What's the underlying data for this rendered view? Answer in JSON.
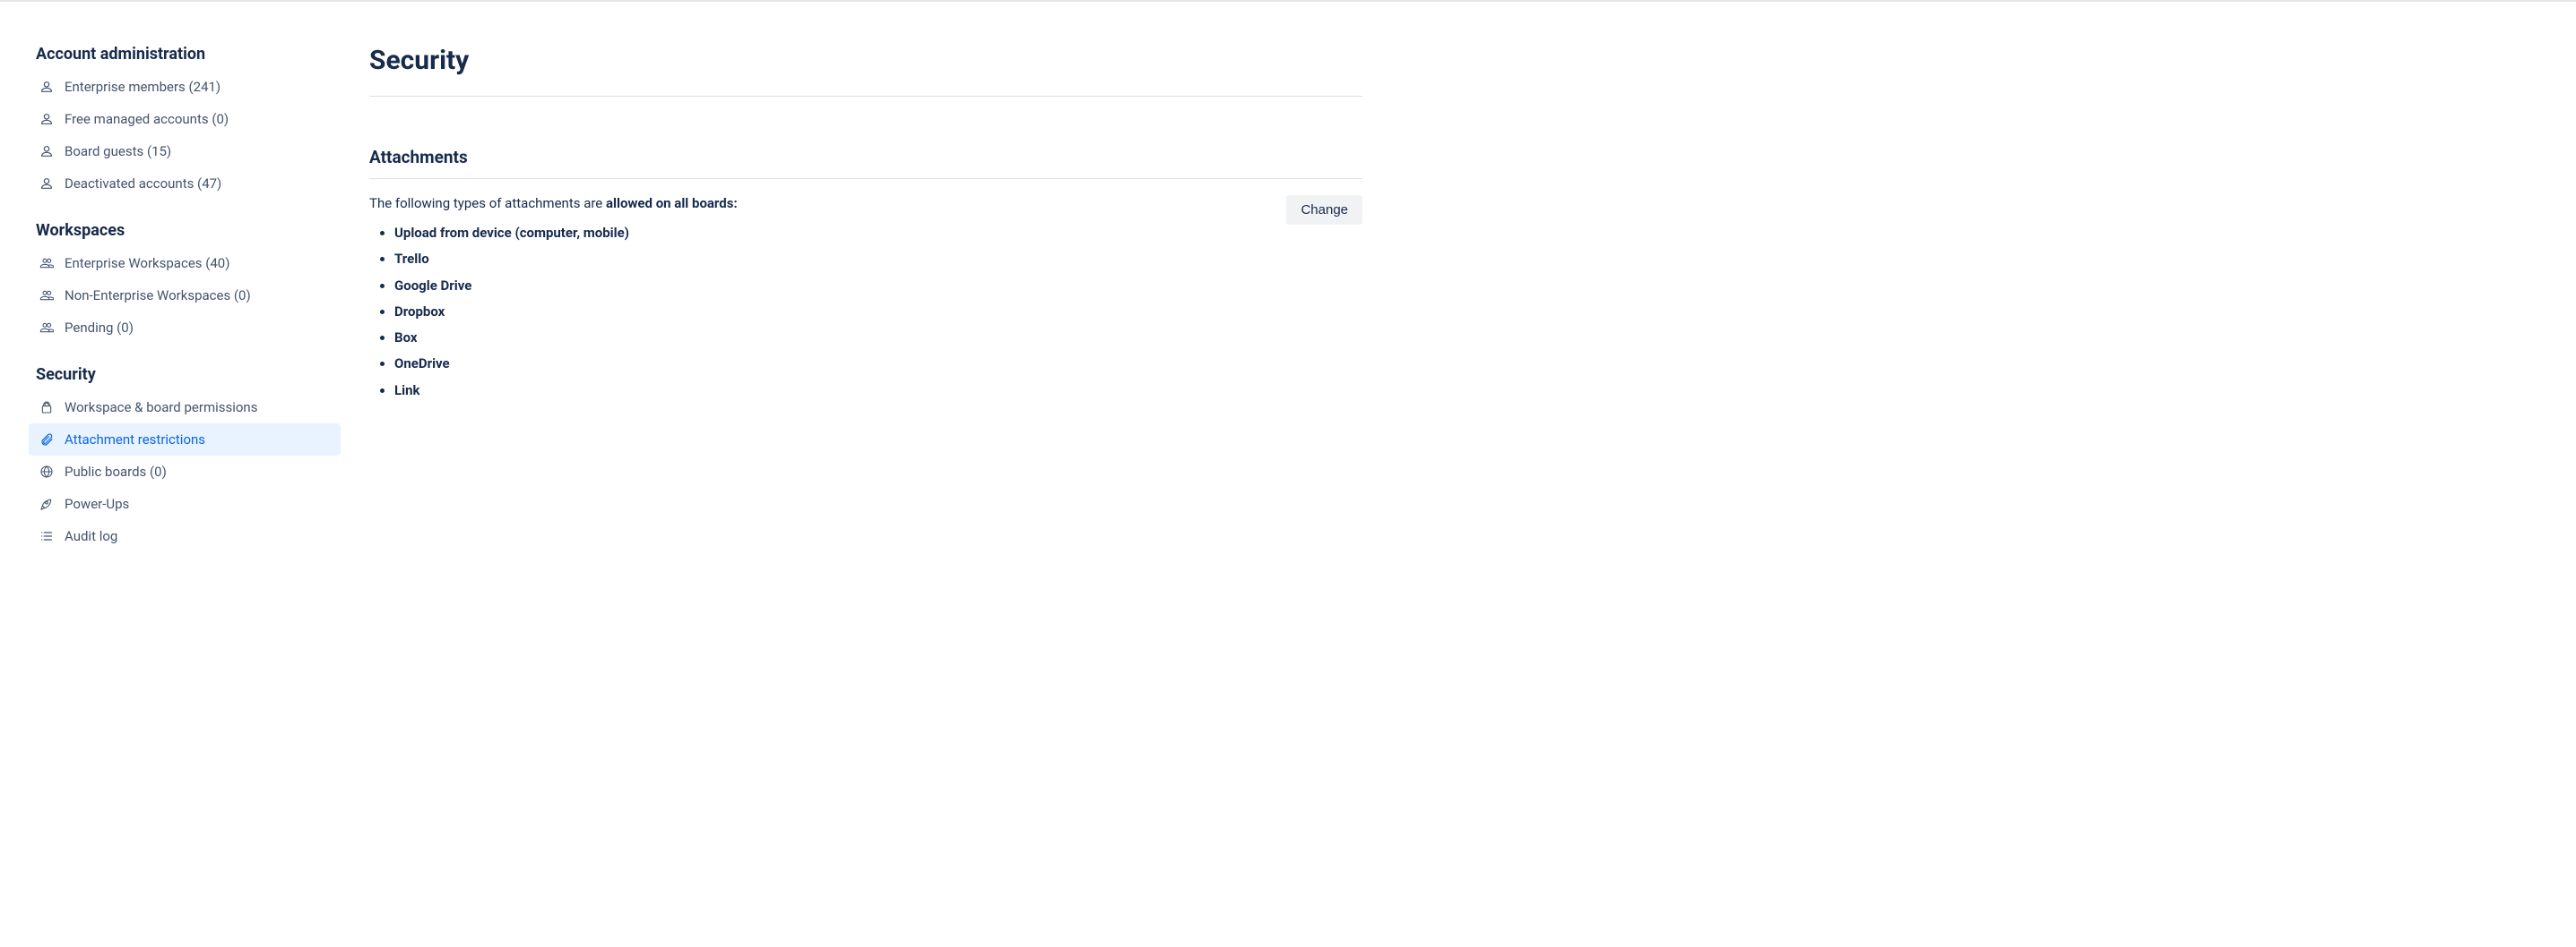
{
  "sidebar": {
    "sections": [
      {
        "heading": "Account administration",
        "items": [
          {
            "label": "Enterprise members (241)",
            "icon": "person",
            "active": false
          },
          {
            "label": "Free managed accounts (0)",
            "icon": "person",
            "active": false
          },
          {
            "label": "Board guests (15)",
            "icon": "person",
            "active": false
          },
          {
            "label": "Deactivated accounts (47)",
            "icon": "person",
            "active": false
          }
        ]
      },
      {
        "heading": "Workspaces",
        "items": [
          {
            "label": "Enterprise Workspaces (40)",
            "icon": "people",
            "active": false
          },
          {
            "label": "Non-Enterprise Workspaces (0)",
            "icon": "people",
            "active": false
          },
          {
            "label": "Pending (0)",
            "icon": "people",
            "active": false
          }
        ]
      },
      {
        "heading": "Security",
        "items": [
          {
            "label": "Workspace & board permissions",
            "icon": "lock",
            "active": false
          },
          {
            "label": "Attachment restrictions",
            "icon": "paperclip",
            "active": true
          },
          {
            "label": "Public boards (0)",
            "icon": "globe",
            "active": false
          },
          {
            "label": "Power-Ups",
            "icon": "rocket",
            "active": false
          },
          {
            "label": "Audit log",
            "icon": "list",
            "active": false
          }
        ]
      }
    ]
  },
  "main": {
    "page_title": "Security",
    "section_title": "Attachments",
    "description_prefix": "The following types of attachments are ",
    "description_emphasis": "allowed on all boards:",
    "bullets": [
      "Upload from device (computer, mobile)",
      "Trello",
      "Google Drive",
      "Dropbox",
      "Box",
      "OneDrive",
      "Link"
    ],
    "change_button": "Change"
  },
  "icons": {
    "person": "person-icon",
    "people": "people-icon",
    "lock": "lock-icon",
    "paperclip": "paperclip-icon",
    "globe": "globe-icon",
    "rocket": "rocket-icon",
    "list": "list-icon"
  }
}
